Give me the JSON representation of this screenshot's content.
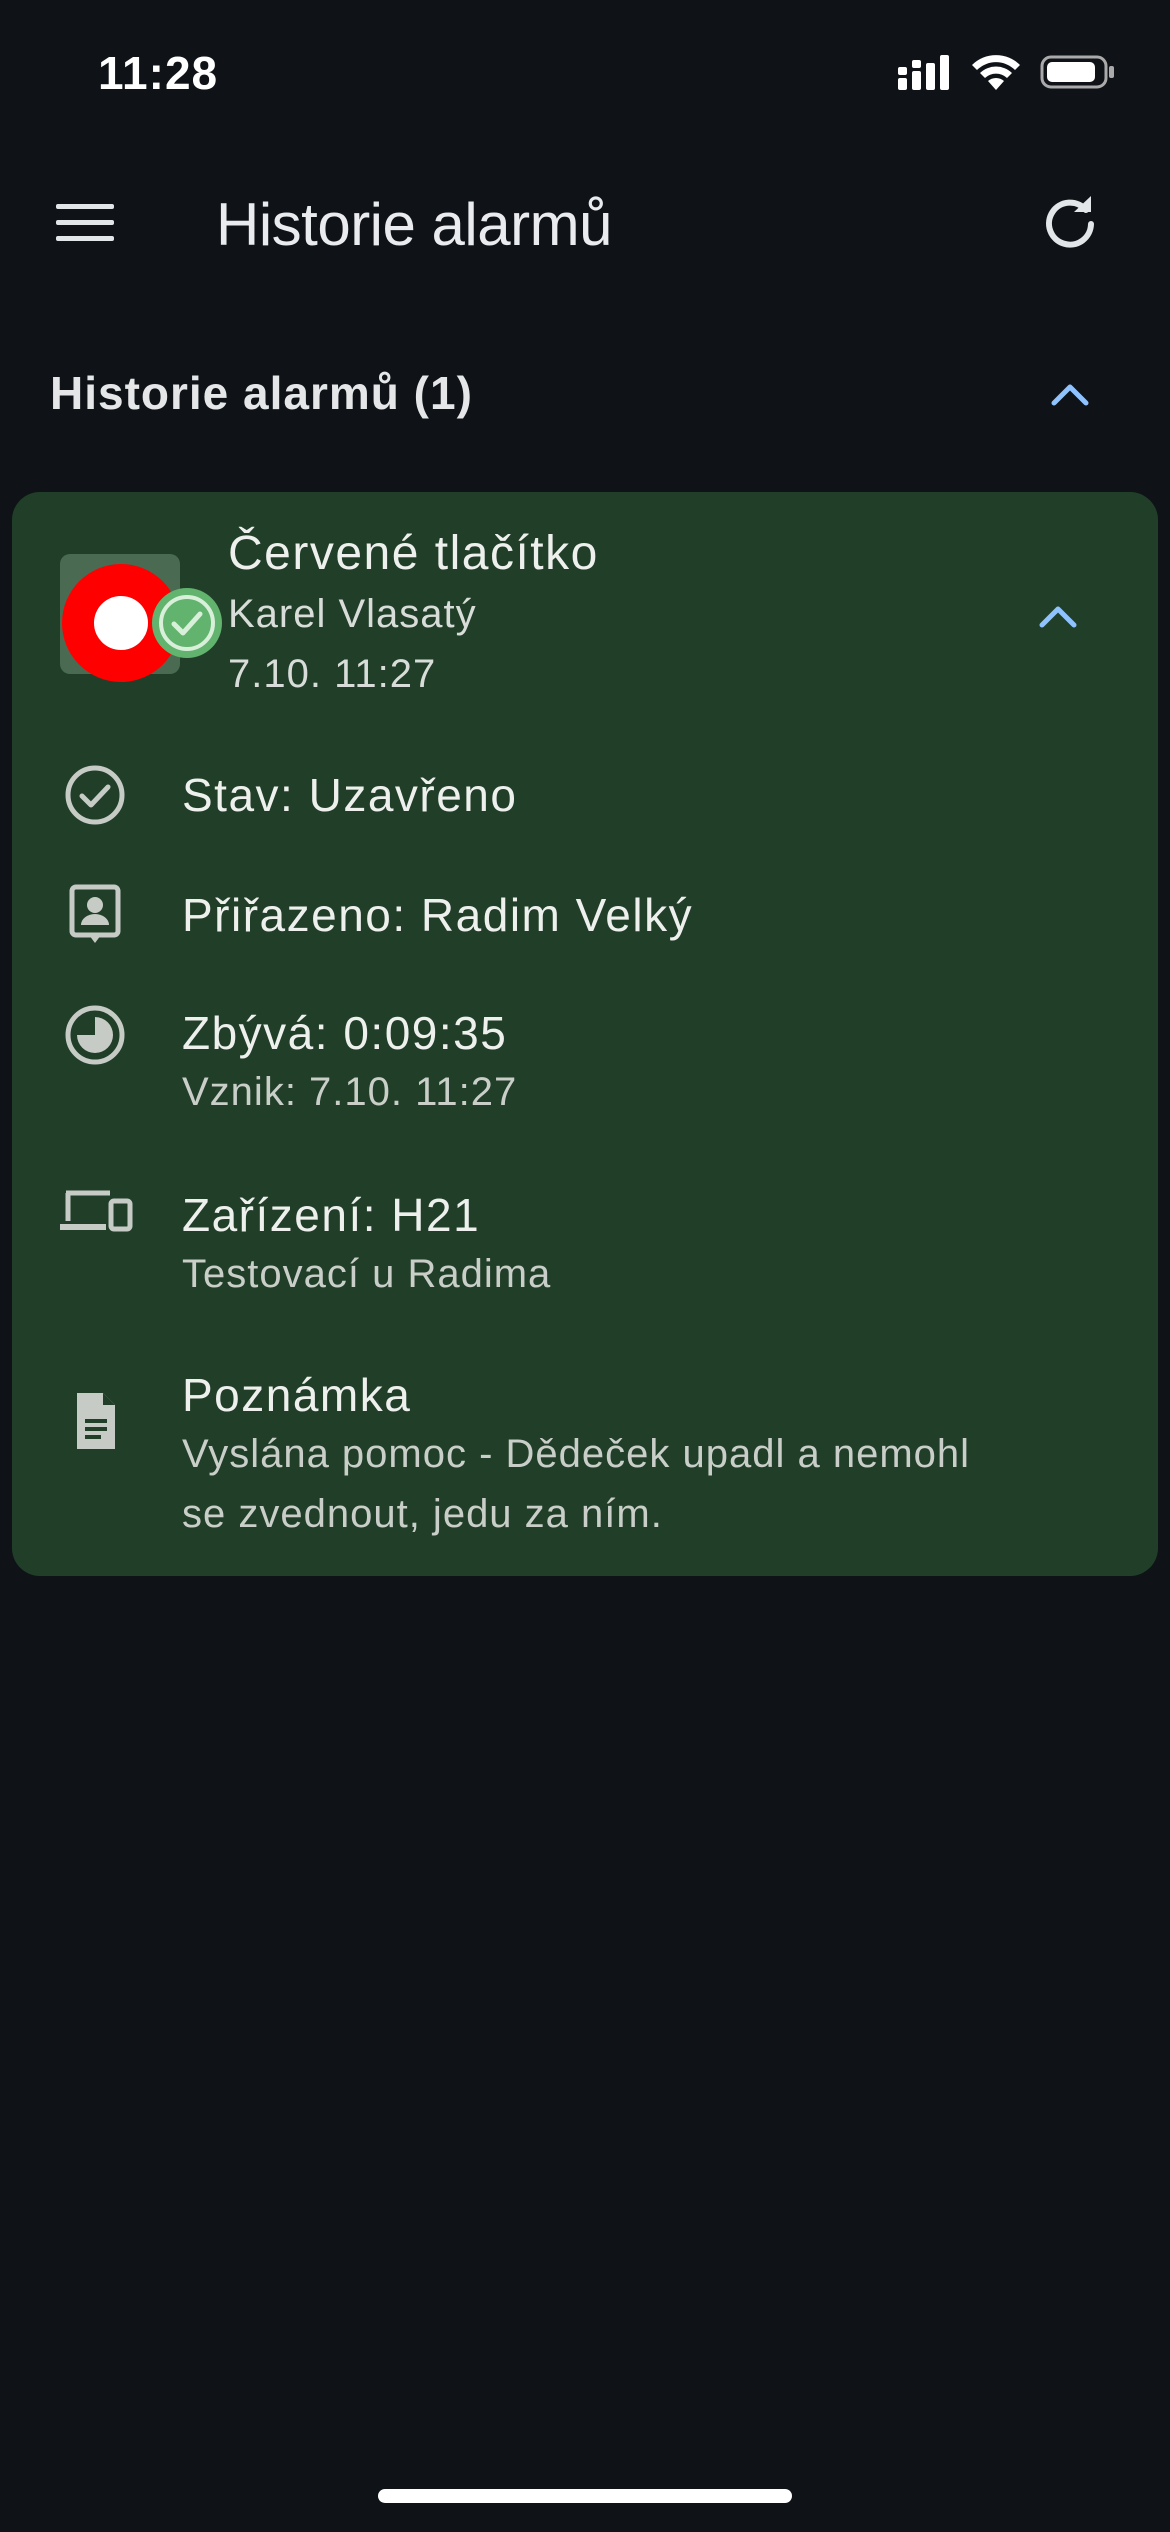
{
  "status_bar": {
    "time": "11:28",
    "icons": [
      "signal-icon",
      "wifi-icon",
      "battery-icon"
    ]
  },
  "app_bar": {
    "title": "Historie alarmů",
    "menu_icon": "menu-icon",
    "refresh_icon": "refresh-icon"
  },
  "section": {
    "title": "Historie alarmů (1)",
    "toggle_icon": "chevron-up-icon"
  },
  "alarm": {
    "title": "Červené tlačítko",
    "person": "Karel Vlasatý",
    "time": "7.10. 11:27",
    "status": "Stav: Uzavřeno",
    "assigned": "Přiřazeno: Radim Velký",
    "remaining": "Zbývá: 0:09:35",
    "created": "Vznik: 7.10. 11:27",
    "device": "Zařízení: H21",
    "device_desc": "Testovací u Radima",
    "note_label": "Poznámka",
    "note_line1": "Vyslána pomoc - Dědeček upadl a nemohl",
    "note_line2": "se zvednout, jedu za ním."
  },
  "colors": {
    "background": "#0f1318",
    "card": "#213f28",
    "accent": "#8fc3ff",
    "alarm_red": "#ff0000",
    "resolved_green": "#61b36d"
  }
}
